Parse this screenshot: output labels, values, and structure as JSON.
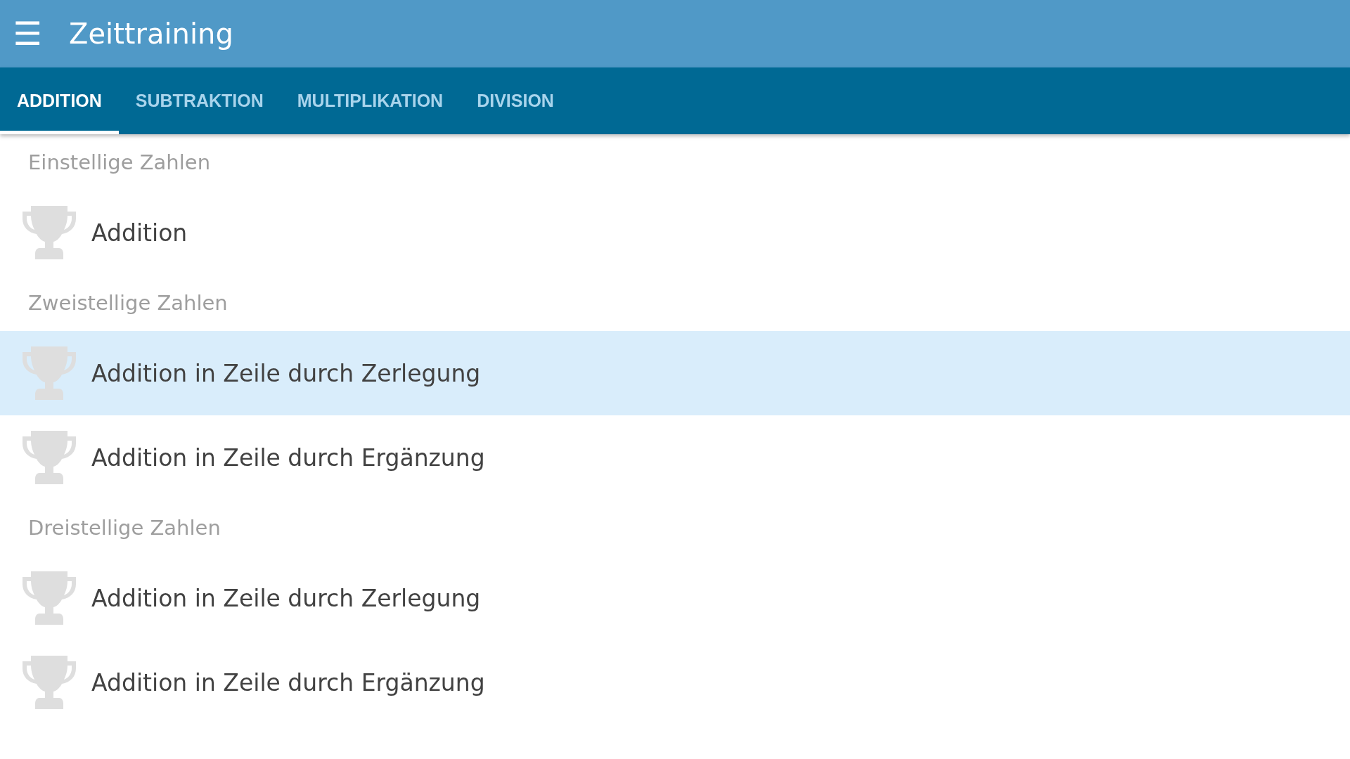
{
  "app_bar": {
    "menu_icon": "☰",
    "title": "Zeittraining"
  },
  "tabs": [
    {
      "label": "ADDITION",
      "selected": true
    },
    {
      "label": "SUBTRAKTION",
      "selected": false
    },
    {
      "label": "MULTIPLIKATION",
      "selected": false
    },
    {
      "label": "DIVISION",
      "selected": false
    }
  ],
  "sections": [
    {
      "title": "Einstellige Zahlen",
      "items": [
        {
          "label": "Addition",
          "selected": false
        }
      ]
    },
    {
      "title": "Zweistellige Zahlen",
      "items": [
        {
          "label": "Addition in Zeile durch Zerlegung",
          "selected": true
        },
        {
          "label": "Addition in Zeile durch Ergänzung",
          "selected": false
        }
      ]
    },
    {
      "title": "Dreistellige Zahlen",
      "items": [
        {
          "label": "Addition in Zeile durch Zerlegung",
          "selected": false
        },
        {
          "label": "Addition in Zeile durch Ergänzung",
          "selected": false
        }
      ]
    }
  ]
}
